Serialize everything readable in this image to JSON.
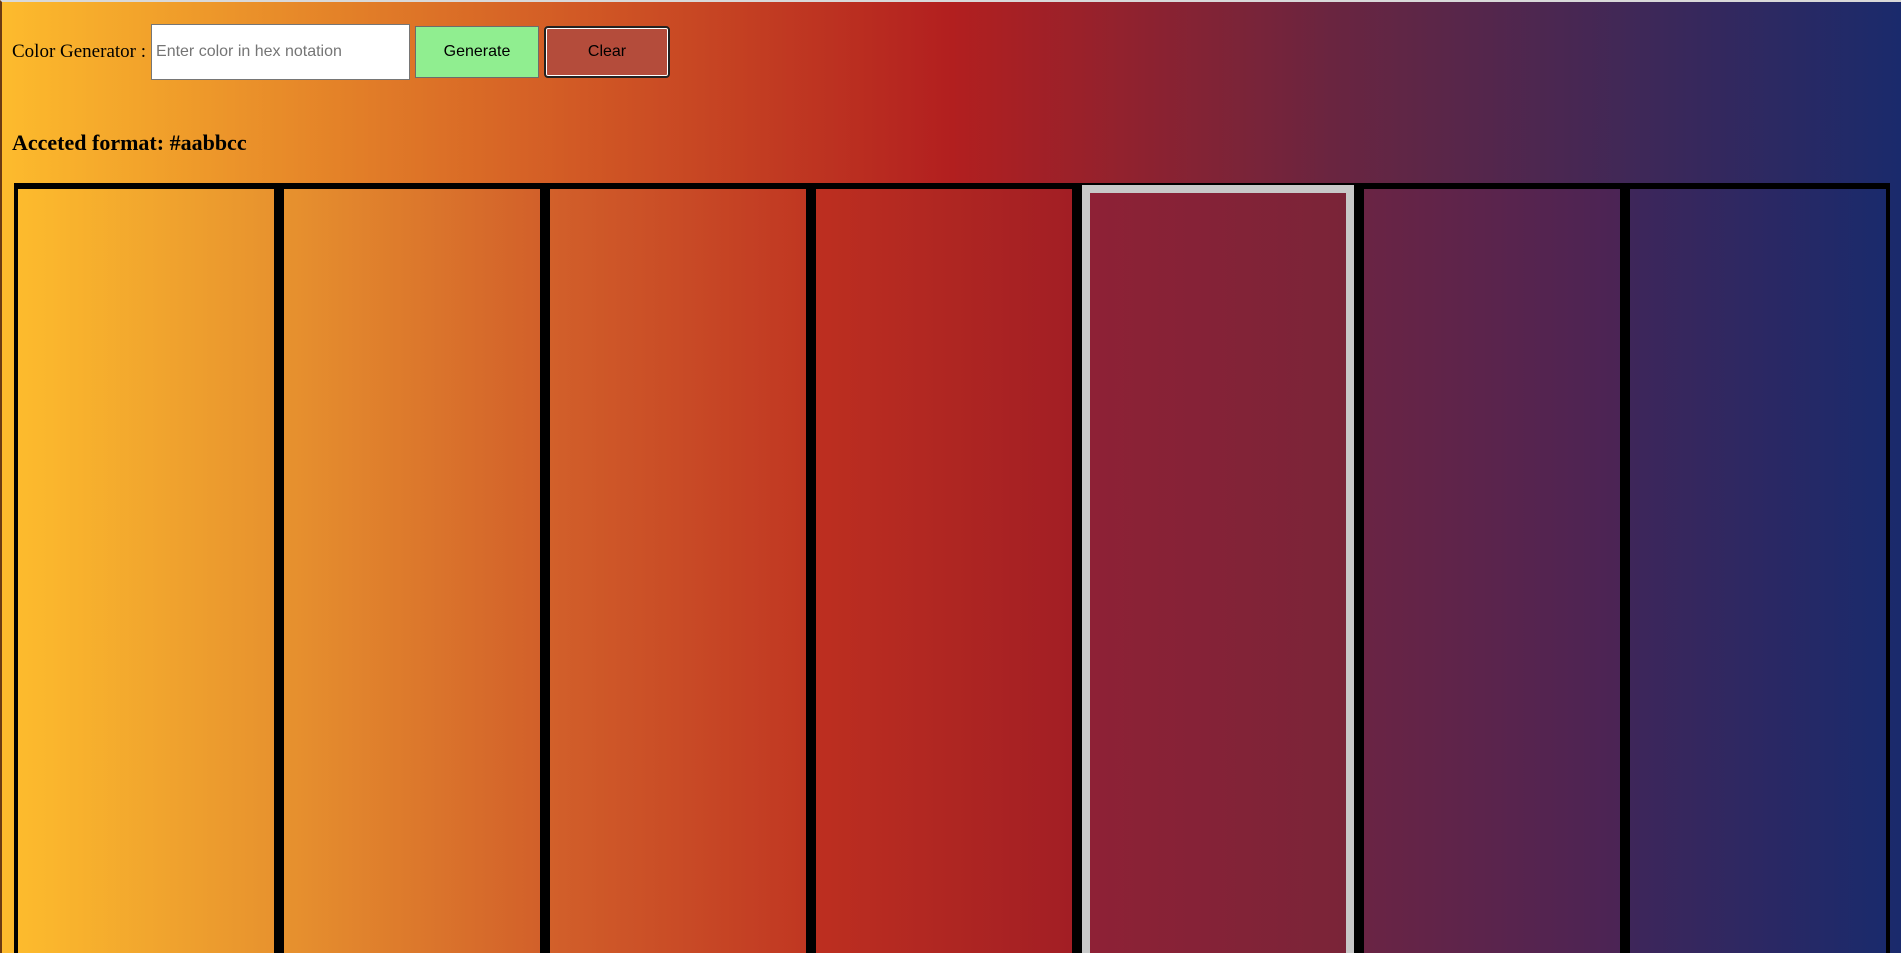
{
  "header": {
    "label": "Color Generator :",
    "input_value": "",
    "input_placeholder": "Enter color in hex notation",
    "generate_label": "Generate",
    "clear_label": "Clear"
  },
  "format_note": "Acceted format: #aabbcc",
  "colors": {
    "gradient_start": "#fdbb2d",
    "gradient_mid": "#b21f1f",
    "gradient_end": "#1a2a6c",
    "generate_button": "#90ee90",
    "clear_button": "#b44c3b",
    "selected_border": "#c8c8c8",
    "grid_border": "#000000"
  },
  "swatches": [
    {
      "from": "#fdbb2d",
      "to": "#e7922e",
      "selected": false
    },
    {
      "from": "#e7922e",
      "to": "#d2602a",
      "selected": false
    },
    {
      "from": "#d2602a",
      "to": "#c03722",
      "selected": false
    },
    {
      "from": "#bd2f20",
      "to": "#a21e24",
      "selected": false
    },
    {
      "from": "#8e2136",
      "to": "#7a2438",
      "selected": true
    },
    {
      "from": "#6a2444",
      "to": "#4b2455",
      "selected": false
    },
    {
      "from": "#3e265a",
      "to": "#1a2a6c",
      "selected": false
    }
  ]
}
